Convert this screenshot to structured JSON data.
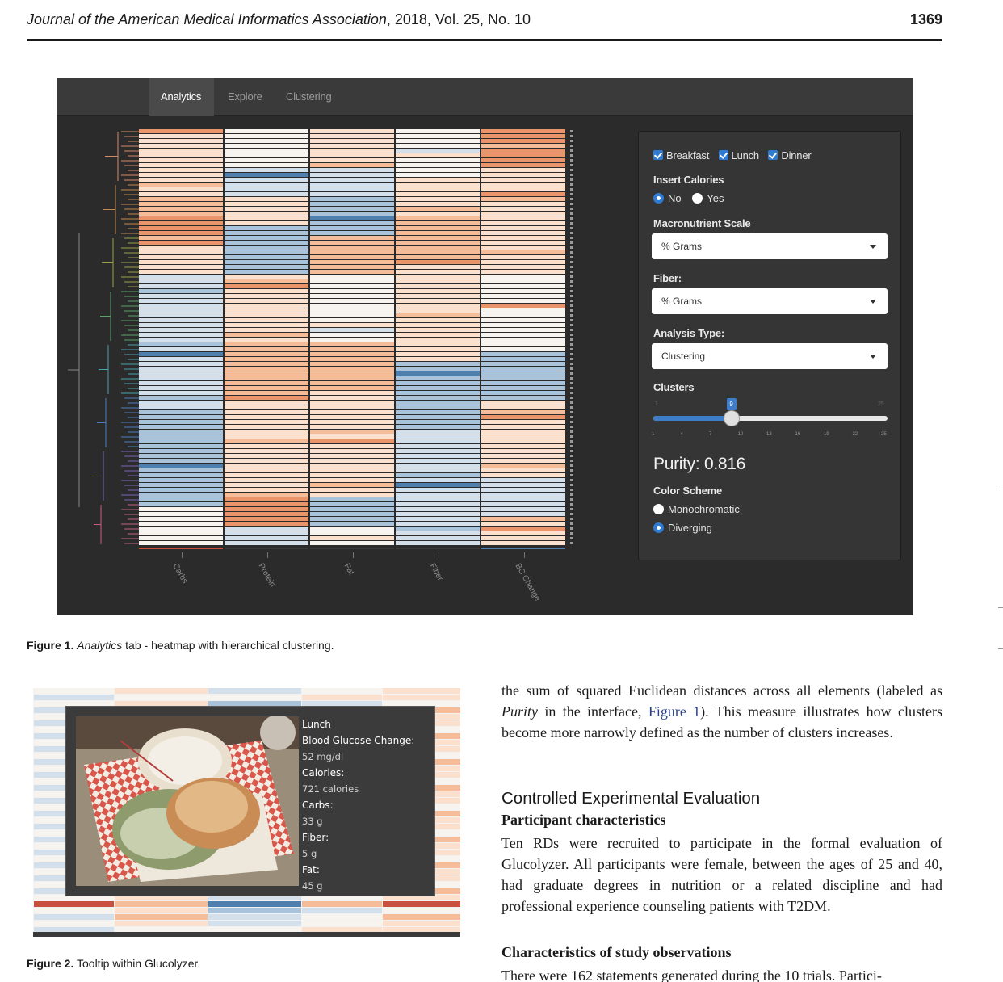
{
  "running_head": {
    "journal": "Journal of the American Medical Informatics Association",
    "details": ", 2018, Vol. 25, No. 10",
    "page_number": "1369"
  },
  "figure1": {
    "tabs": [
      "Analytics",
      "Explore",
      "Clustering"
    ],
    "active_tab": "Analytics",
    "columns": [
      "Carbs",
      "Protein",
      "Fat",
      "Fiber",
      "BC Change"
    ],
    "controls": {
      "meals": [
        "Breakfast",
        "Lunch",
        "Dinner"
      ],
      "insert_calories_label": "Insert Calories",
      "insert_calories_options": [
        "No",
        "Yes"
      ],
      "insert_calories_selected": "No",
      "macronutrient_scale_label": "Macronutrient Scale",
      "macronutrient_scale_value": "% Grams",
      "fiber_label": "Fiber:",
      "fiber_value": "% Grams",
      "analysis_type_label": "Analysis Type:",
      "analysis_type_value": "Clustering",
      "clusters_label": "Clusters",
      "clusters_value": 9,
      "clusters_min": 1,
      "clusters_max": 25,
      "slider_ticks": [
        "1",
        "4",
        "7",
        "10",
        "13",
        "16",
        "19",
        "22",
        "25"
      ],
      "purity_text": "Purity: 0.816",
      "color_scheme_label": "Color Scheme",
      "color_scheme_options": [
        "Monochromatic",
        "Diverging"
      ],
      "color_scheme_selected": "Diverging"
    },
    "palette": {
      "orange_strong": "#e9946a",
      "orange_mid": "#f4bc98",
      "orange_light": "#fbe1cd",
      "white": "#f7f3ef",
      "blue_light": "#d3dfea",
      "blue_mid": "#a9c3da",
      "blue_strong": "#4f7fae",
      "red": "#c9503f"
    },
    "caption_label": "Figure 1.",
    "caption_italic": "Analytics",
    "caption_rest": " tab - heatmap with hierarchical clustering."
  },
  "figure2": {
    "tooltip_lines": [
      {
        "text": "Lunch",
        "kind": "label"
      },
      {
        "text": "Blood Glucose Change:",
        "kind": "label"
      },
      {
        "text": "52 mg/dl",
        "kind": "value"
      },
      {
        "text": "Calories:",
        "kind": "label"
      },
      {
        "text": "721 calories",
        "kind": "value"
      },
      {
        "text": "Carbs:",
        "kind": "label"
      },
      {
        "text": "33 g",
        "kind": "value"
      },
      {
        "text": "Fiber:",
        "kind": "label"
      },
      {
        "text": "5 g",
        "kind": "value"
      },
      {
        "text": "Fat:",
        "kind": "label"
      },
      {
        "text": "45 g",
        "kind": "value"
      }
    ],
    "caption_label": "Figure 2.",
    "caption_rest": " Tooltip within Glucolyzer."
  },
  "text": {
    "para1_a": "the sum of squared Euclidean distances across all elements (labeled as ",
    "para1_italic": "Purity",
    "para1_b": " in the interface, ",
    "para1_link": "Figure 1",
    "para1_c": "). This measure illustrates how clusters become more narrowly defined as the number of clusters increases.",
    "section_heading": "Controlled Experimental Evaluation",
    "sub1": "Participant characteristics",
    "para2": "Ten RDs were recruited to participate in the formal evaluation of Glucolyzer. All participants were female, between the ages of 25 and 40, had graduate degrees in nutrition or a related discipline and had professional experience counseling patients with T2DM.",
    "sub2": "Characteristics of study observations",
    "para3": "There were 162 statements generated during the 10 trials. Partici-"
  }
}
